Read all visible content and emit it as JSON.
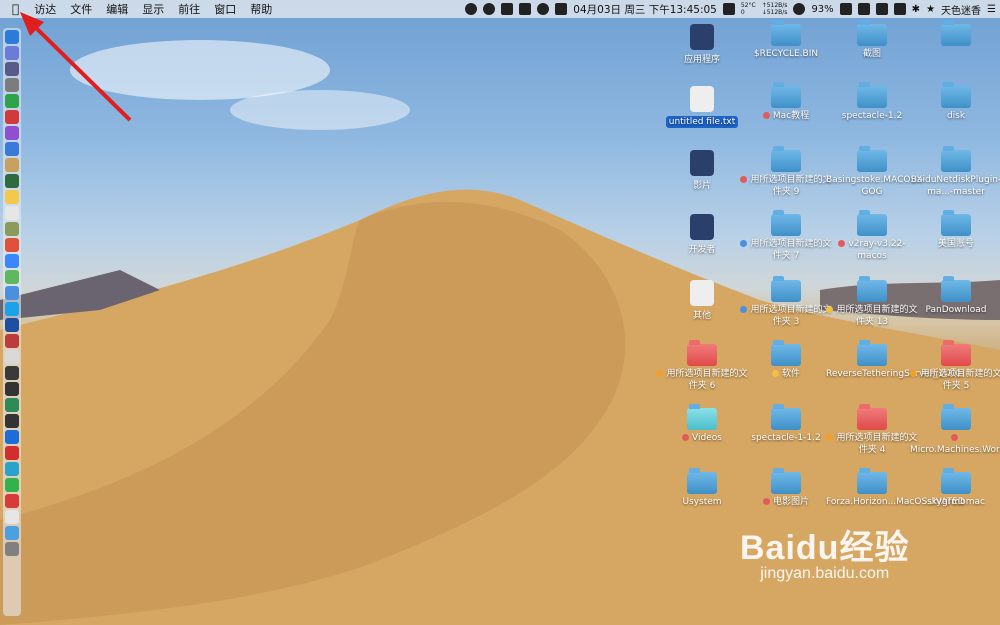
{
  "menubar": {
    "apple": "",
    "items": [
      "访达",
      "文件",
      "编辑",
      "显示",
      "前往",
      "窗口",
      "帮助"
    ],
    "status": {
      "temp": "52°C",
      "ten": "0",
      "up": "↑512B/s",
      "down": "↓512B/s",
      "clock": "04月03日 周三 下午13:45:05",
      "battery": "93%",
      "user": "天色迷香"
    }
  },
  "desktop_icons": [
    {
      "label": "应用程序",
      "kind": "app",
      "tag": ""
    },
    {
      "label": "$RECYCLE.BIN",
      "kind": "folder",
      "tag": ""
    },
    {
      "label": "截图",
      "kind": "folder",
      "tag": ""
    },
    {
      "label": "",
      "kind": "folder",
      "tag": ""
    },
    {
      "label": "untitled file.txt",
      "kind": "file",
      "tag": "",
      "selected": true
    },
    {
      "label": "Mac教程",
      "kind": "folder",
      "tag": "#e45a5a"
    },
    {
      "label": "spectacle-1.2",
      "kind": "folder",
      "tag": ""
    },
    {
      "label": "disk",
      "kind": "folder",
      "tag": ""
    },
    {
      "label": "影片",
      "kind": "app",
      "tag": ""
    },
    {
      "label": "用所选项目新建的文件夹 9",
      "kind": "folder",
      "tag": "#e45a5a"
    },
    {
      "label": "Basingstoke.MACOSX-GOG",
      "kind": "folder",
      "tag": ""
    },
    {
      "label": "BaiduNetdiskPlugin-ma...-master",
      "kind": "folder",
      "tag": ""
    },
    {
      "label": "开发者",
      "kind": "app",
      "tag": ""
    },
    {
      "label": "用所选项目新建的文件夹 7",
      "kind": "folder",
      "tag": "#4a8fe0"
    },
    {
      "label": "v2ray-v3.22-macos",
      "kind": "folder",
      "tag": "#e45a5a"
    },
    {
      "label": "美国账号",
      "kind": "folder",
      "tag": ""
    },
    {
      "label": "其他",
      "kind": "file",
      "tag": ""
    },
    {
      "label": "用所选项目新建的文件夹 3",
      "kind": "folder",
      "tag": "#4a8fe0"
    },
    {
      "label": "用所选项目新建的文件夹 13",
      "kind": "folder",
      "tag": "#f0c040"
    },
    {
      "label": "PanDownload",
      "kind": "folder",
      "tag": ""
    },
    {
      "label": "用所选项目新建的文件夹 6",
      "kind": "folder-red",
      "tag": "#f0a030"
    },
    {
      "label": "软件",
      "kind": "folder",
      "tag": "#f0c040"
    },
    {
      "label": "ReverseTetheringServer_1.2.0",
      "kind": "folder",
      "tag": ""
    },
    {
      "label": "用所选项目新建的文件夹 5",
      "kind": "folder-red",
      "tag": "#f0a030"
    },
    {
      "label": "Videos",
      "kind": "folder-teal",
      "tag": "#e45a5a"
    },
    {
      "label": "spectacle-1-1.2",
      "kind": "folder",
      "tag": ""
    },
    {
      "label": "用所选项目新建的文件夹 4",
      "kind": "folder-red",
      "tag": "#f0a030"
    },
    {
      "label": "Micro.Machines.Worl...IVATED",
      "kind": "folder",
      "tag": "#e45a5a"
    },
    {
      "label": "Usystem",
      "kind": "folder",
      "tag": ""
    },
    {
      "label": "电影图片",
      "kind": "folder",
      "tag": "#e45a5a"
    },
    {
      "label": "Forza.Horizon...MacOS..IVATED",
      "kind": "folder",
      "tag": ""
    },
    {
      "label": "skygrmbmac",
      "kind": "folder",
      "tag": ""
    }
  ],
  "dock_colors": [
    "#2d7bd8",
    "#6a7bd8",
    "#5a5a8a",
    "#7c7c7c",
    "#2fa34a",
    "#d13a3a",
    "#8f4fcf",
    "#3a7ad8",
    "#c9a15f",
    "#2f6b3f",
    "#f2c94c",
    "#e6e6e6",
    "#8a9b5a",
    "#e0503a",
    "#3a86ff",
    "#5fb85f",
    "#4a8fe0",
    "#1aa3e8",
    "#1f4fa0",
    "#bd3b3b",
    "#d9d9d9",
    "#3a3a3a",
    "#343434",
    "#2e8b57",
    "#333",
    "#1e6cd8",
    "#d22e2e",
    "#2aa3cc",
    "#32b24a",
    "#d83a3a",
    "#e6e6e6",
    "#4aa0e0",
    "#808080"
  ],
  "watermark": {
    "logo": "Baidu经验",
    "url": "jingyan.baidu.com"
  }
}
